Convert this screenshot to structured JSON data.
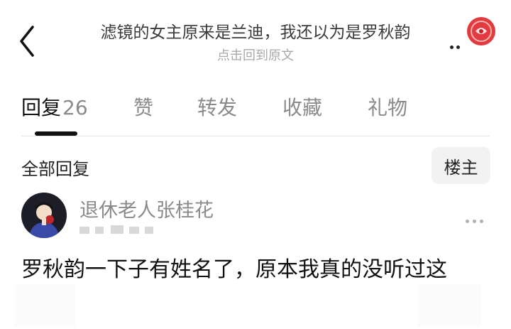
{
  "header": {
    "title": "滤镜的女主原来是兰迪，我还以为是罗秋韵",
    "subtitle": "点击回到原文"
  },
  "tabs": [
    {
      "label": "回复",
      "count": "26"
    },
    {
      "label": "赞"
    },
    {
      "label": "转发"
    },
    {
      "label": "收藏"
    },
    {
      "label": "礼物"
    }
  ],
  "section": {
    "all_replies": "全部回复",
    "owner_button": "楼主"
  },
  "reply": {
    "username": "退休老人张桂花",
    "text": "罗秋韵一下子有姓名了，原本我真的没听过这"
  },
  "colors": {
    "accent": "#111111",
    "muted": "#8a8a8a",
    "emblem": "#d9272e"
  },
  "icons": [
    "back-arrow-icon",
    "more-icon",
    "emblem-icon",
    "avatar"
  ]
}
